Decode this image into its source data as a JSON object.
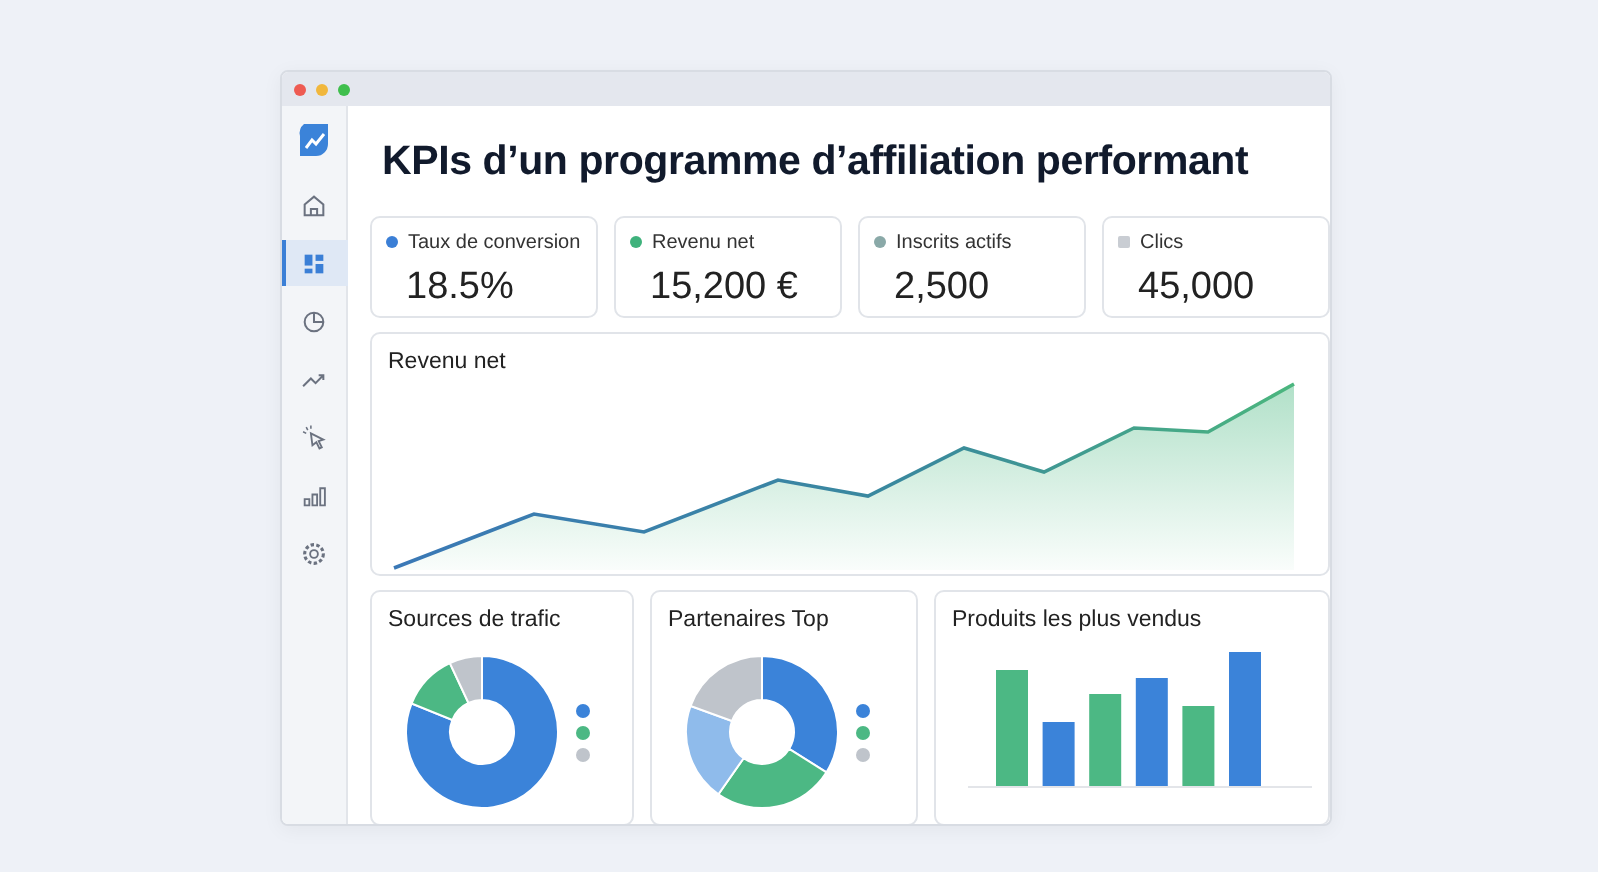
{
  "sidebar": {
    "items": [
      {
        "selected": false
      },
      {
        "selected": true
      },
      {
        "selected": false
      },
      {
        "selected": false
      },
      {
        "selected": false
      },
      {
        "selected": false
      },
      {
        "selected": false
      }
    ]
  },
  "title": "KPIs d’un programme d’affiliation performant",
  "kpis": [
    {
      "label": "Taux de conversion",
      "value": "18.5%",
      "color": "#3b7fd6"
    },
    {
      "label": "Revenu net",
      "value": "15,200 €",
      "color": "#3fb27c"
    },
    {
      "label": "Inscrits actifs",
      "value": "2,500",
      "color": "#8aa9a8"
    },
    {
      "label": "Clics",
      "value": "45,000",
      "color": "#c9cdd3"
    }
  ],
  "revenue_chart": {
    "title": "Revenu net"
  },
  "traffic_sources": {
    "title": "Sources de trafic",
    "legend": [
      {
        "color": "#3b83d9"
      },
      {
        "color": "#4cb884"
      },
      {
        "color": "#bfc4cb"
      }
    ]
  },
  "top_partners": {
    "title": "Partenaires Top",
    "legend": [
      {
        "color": "#3b83d9"
      },
      {
        "color": "#4cb884"
      },
      {
        "color": "#bfc4cb"
      }
    ]
  },
  "best_sellers": {
    "title": "Produits les plus vendus"
  }
}
